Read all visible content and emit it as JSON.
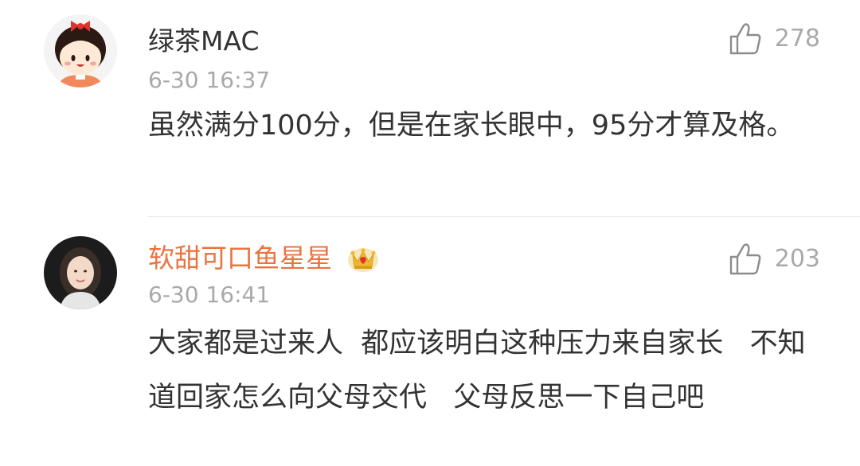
{
  "comments": [
    {
      "username": "绿茶MAC",
      "timestamp": "6-30 16:37",
      "likes": "278",
      "text": "虽然满分100分，但是在家长眼中，95分才算及格。",
      "username_color": "#333333"
    },
    {
      "username": "软甜可口鱼星星",
      "timestamp": "6-30 16:41",
      "likes": "203",
      "text": "大家都是过来人  都应该明白这种压力来自家长   不知道回家怎么向父母交代   父母反思一下自己吧",
      "username_color": "#eb7340",
      "badge_icon": "crown-badge-icon"
    }
  ]
}
